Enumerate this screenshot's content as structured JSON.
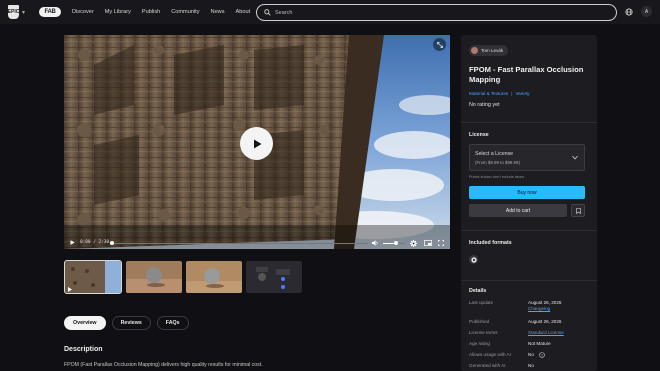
{
  "topbar": {
    "epic_logo": "EPIC",
    "fab_logo": "FAB",
    "nav": [
      "Discover",
      "My Library",
      "Publish",
      "Community",
      "News",
      "About"
    ],
    "search_placeholder": "Search",
    "avatar_initial": "A"
  },
  "video": {
    "time": "0:00 / 2:30",
    "progress": 0.0,
    "volume": 0.6
  },
  "tabs": [
    "Overview",
    "Reviews",
    "FAQs"
  ],
  "description": {
    "title": "Description",
    "text": "FPOM (Fast Parallax Occlusion Mapping) delivers high quality results for minimal cost."
  },
  "product": {
    "seller": "Tom Levák",
    "title": "FPOM - Fast Parallax Occlusion Mapping",
    "categories": [
      "Material & Textures",
      "Variety"
    ],
    "rating": "No rating yet"
  },
  "license": {
    "heading": "License",
    "select_label": "Select a License",
    "select_range": "(From $9.99 to $99.99)",
    "note": "Prices shown don't include taxes",
    "buy_label": "Buy now",
    "cart_label": "Add to cart"
  },
  "formats": {
    "heading": "Included formats"
  },
  "details": {
    "heading": "Details",
    "rows": [
      {
        "key": "Last update",
        "value": "August 26, 2026",
        "sub": "Changelog"
      },
      {
        "key": "Published",
        "value": "August 26, 2026"
      },
      {
        "key": "License terms",
        "value": "Standard License"
      },
      {
        "key": "Age rating",
        "value": "Not Mature"
      },
      {
        "key": "Allows usage with AI",
        "value": "No"
      },
      {
        "key": "Generated with AI",
        "value": "No"
      }
    ]
  },
  "colors": {
    "accent": "#26bbff",
    "link": "#4aa3ff",
    "background": "#101014",
    "panel": "#1c1c21"
  }
}
